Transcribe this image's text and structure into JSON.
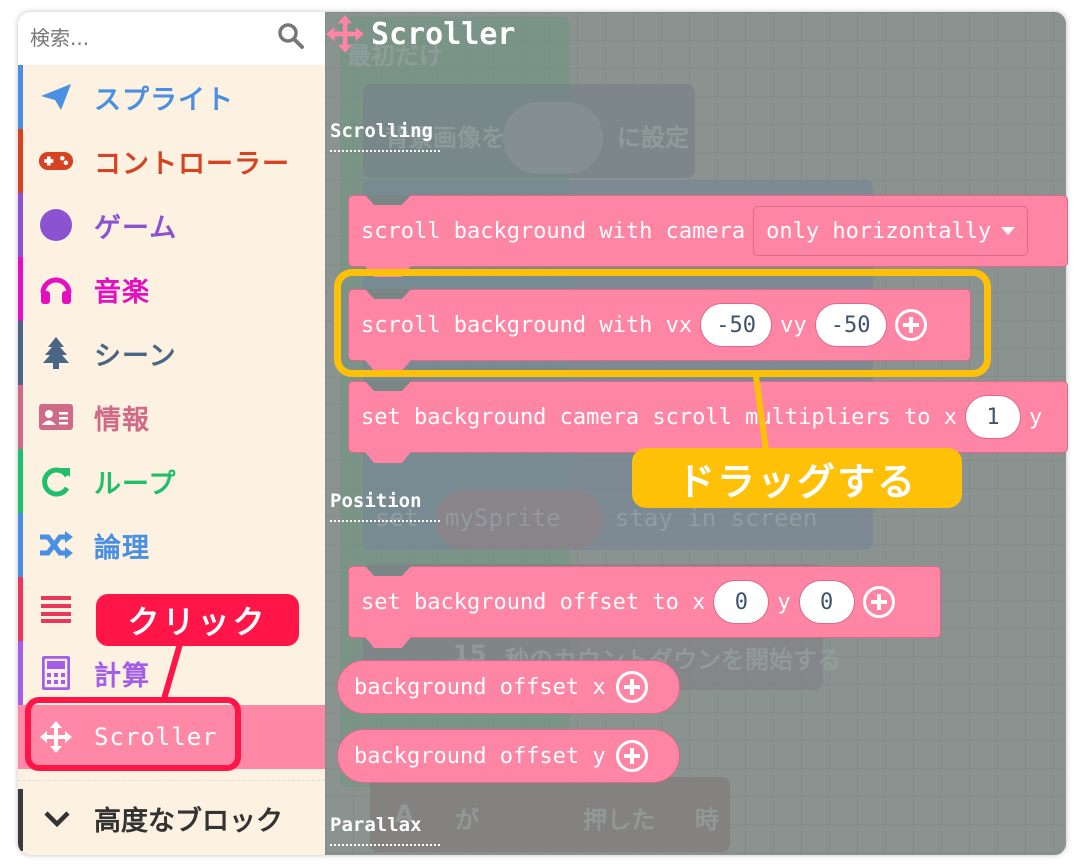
{
  "search": {
    "placeholder": "検索..."
  },
  "sidebar": {
    "categories": [
      {
        "label": "スプライト",
        "icon": "paper-plane-icon",
        "color": "#4a90e2"
      },
      {
        "label": "コントローラー",
        "icon": "gamepad-icon",
        "color": "#d54322"
      },
      {
        "label": "ゲーム",
        "icon": "circle-icon",
        "color": "#8b53d1"
      },
      {
        "label": "音楽",
        "icon": "headphones-icon",
        "color": "#e30fc0"
      },
      {
        "label": "シーン",
        "icon": "tree-icon",
        "color": "#4b6584"
      },
      {
        "label": "情報",
        "icon": "id-card-icon",
        "color": "#cf6a87"
      },
      {
        "label": "ループ",
        "icon": "refresh-icon",
        "color": "#20bf6b"
      },
      {
        "label": "論理",
        "icon": "shuffle-icon",
        "color": "#4a90e2"
      },
      {
        "label": "",
        "icon": "list-icon",
        "color": "#e8375a"
      },
      {
        "label": "計算",
        "icon": "calculator-icon",
        "color": "#a25ee9"
      },
      {
        "label": "Scroller",
        "icon": "move-icon",
        "color": "#ff85a5",
        "selected": true
      }
    ],
    "advanced": {
      "label": "高度なブロック",
      "icon": "chevron-down-icon"
    }
  },
  "workspace": {
    "background_blocks": {
      "on_start": "最初だけ",
      "set_bg_image_pre": "背景画像を",
      "set_bg_image_post": "に設定",
      "sprite_var": "mySprite",
      "stay_in_screen_set": "set",
      "stay_in_screen_text": "stay in screen",
      "countdown_value": "15",
      "countdown_text": "秒のカウントダウンを開始する",
      "button_a": "A",
      "button_ga": "が",
      "button_pressed": "押した",
      "button_when": "時"
    }
  },
  "flyout": {
    "title": "Scroller",
    "sections": {
      "scrolling": "Scrolling",
      "position": "Position",
      "parallax": "Parallax"
    },
    "blocks": {
      "scroll_camera": {
        "text": "scroll background with camera",
        "dropdown": "only horizontally"
      },
      "scroll_vel": {
        "text": "scroll background with vx",
        "vx": "-50",
        "vy_label": "vy",
        "vy": "-50"
      },
      "multipliers": {
        "text": "set background camera scroll multipliers to x",
        "x": "1",
        "y_label": "y"
      },
      "set_offset": {
        "text": "set background offset to x",
        "x": "0",
        "y_label": "y",
        "y": "0"
      },
      "offset_x": {
        "text": "background offset x"
      },
      "offset_y": {
        "text": "background offset y"
      }
    }
  },
  "annotations": {
    "drag": "ドラッグする",
    "click": "クリック",
    "drag_color": "#ffc107",
    "click_color": "#ff1548"
  }
}
